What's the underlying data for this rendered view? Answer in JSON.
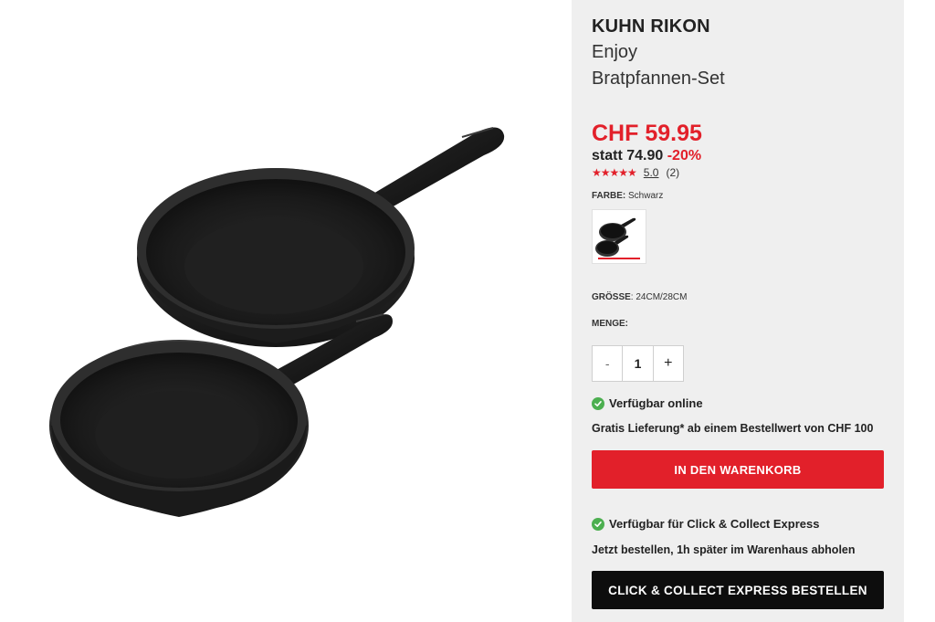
{
  "product": {
    "brand": "KUHN RIKON",
    "title_line1": "Enjoy",
    "title_line2": "Bratpfannen-Set",
    "image_alt": "Bratpfannen-Set, zwei schwarze Pfannen"
  },
  "pricing": {
    "price": "CHF 59.95",
    "old_price": "statt 74.90",
    "discount": "-20%"
  },
  "rating": {
    "stars": "★★★★★",
    "value": "5.0",
    "count": "(2)"
  },
  "color": {
    "label": "FARBE:",
    "value": "Schwarz"
  },
  "size": {
    "label": "GRÖSSE",
    "value": ": 24CM/28CM"
  },
  "quantity": {
    "label": "MENGE:",
    "minus": "-",
    "value": "1",
    "plus": "+"
  },
  "online": {
    "availability": "Verfügbar online",
    "shipping_info": "Gratis Lieferung* ab einem Bestellwert von CHF 100",
    "cta": "IN DEN WARENKORB"
  },
  "click_collect": {
    "availability": "Verfügbar für Click & Collect Express",
    "info": "Jetzt bestellen, 1h später im Warenhaus abholen",
    "cta": "CLICK & COLLECT EXPRESS BESTELLEN"
  },
  "colors": {
    "accent_red": "#e2202a",
    "check_green": "#4caf50",
    "panel_bg": "#efefef",
    "cta_black": "#0d0d0d"
  },
  "icons": {
    "availability": "check-circle-icon",
    "rating": "star-icon"
  }
}
